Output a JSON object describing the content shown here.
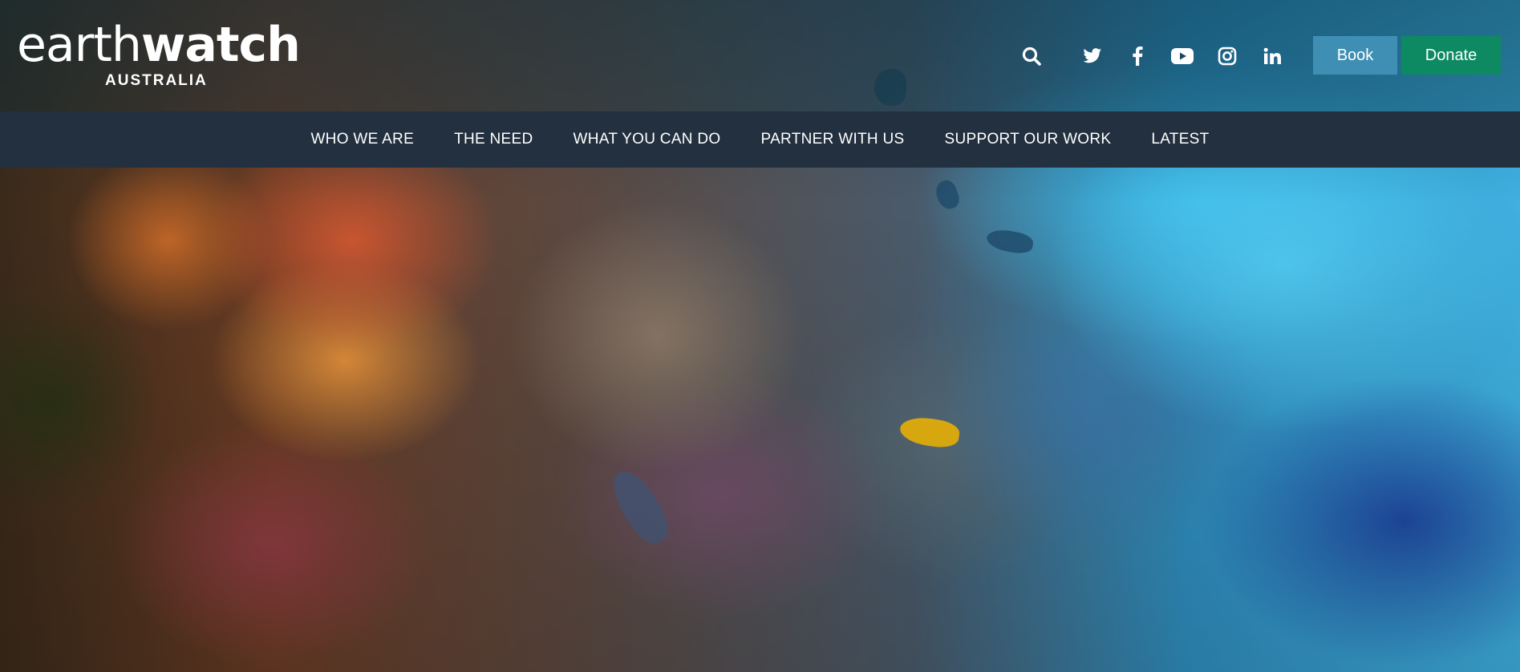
{
  "brand": {
    "logo_light": "earth",
    "logo_bold": "watch",
    "logo_sub": "AUSTRALIA"
  },
  "header": {
    "icons": [
      {
        "name": "search-icon",
        "label": "search"
      },
      {
        "name": "twitter-icon",
        "label": "twitter"
      },
      {
        "name": "facebook-icon",
        "label": "facebook"
      },
      {
        "name": "youtube-icon",
        "label": "youtube"
      },
      {
        "name": "instagram-icon",
        "label": "instagram"
      },
      {
        "name": "linkedin-icon",
        "label": "linkedin"
      }
    ],
    "book_label": "Book",
    "donate_label": "Donate"
  },
  "nav": {
    "items": [
      {
        "label": "WHO WE ARE"
      },
      {
        "label": "THE NEED"
      },
      {
        "label": "WHAT YOU CAN DO"
      },
      {
        "label": "PARTNER WITH US"
      },
      {
        "label": "SUPPORT OUR WORK"
      },
      {
        "label": "LATEST"
      }
    ]
  },
  "colors": {
    "nav_bg": "#23303f",
    "book_bg": "#3f8fb5",
    "donate_bg": "#0e8a62",
    "text": "#ffffff"
  }
}
